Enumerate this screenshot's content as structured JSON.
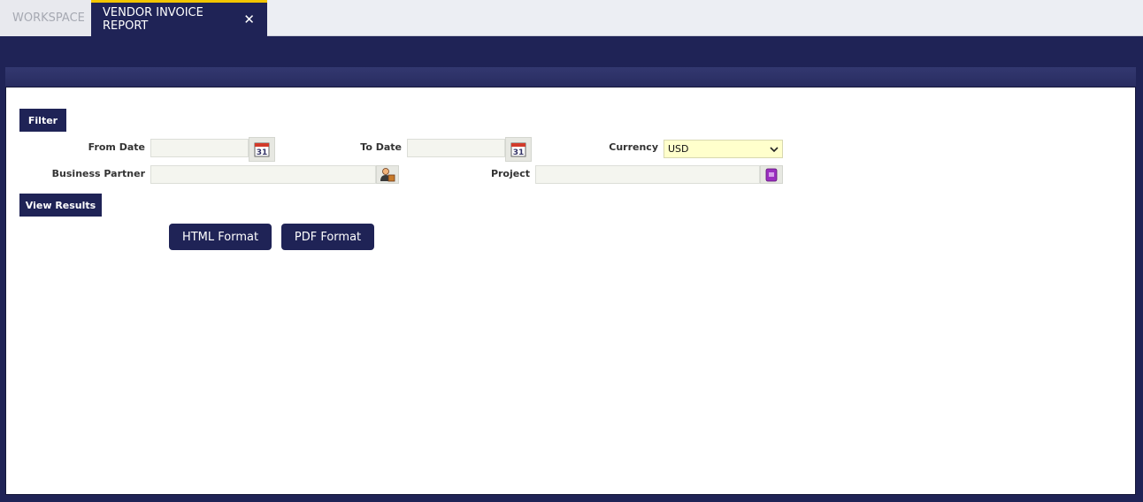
{
  "tabs": {
    "workspace": "WORKSPACE",
    "active": "VENDOR INVOICE REPORT",
    "close_glyph": "✕"
  },
  "filter": {
    "filter_button": "Filter",
    "from_date_label": "From Date",
    "from_date_value": "",
    "to_date_label": "To Date",
    "to_date_value": "",
    "currency_label": "Currency",
    "currency_value": "USD",
    "business_partner_label": "Business Partner",
    "business_partner_value": "",
    "project_label": "Project",
    "project_value": ""
  },
  "actions": {
    "view_results": "View Results",
    "html_format": "HTML Format",
    "pdf_format": "PDF Format"
  },
  "icons": {
    "calendar_day": "31",
    "calendar": "calendar-icon",
    "business_partner": "business-partner-icon",
    "project": "project-icon",
    "dropdown": "chevron-down-icon"
  },
  "colors": {
    "brand_navy": "#1f2356",
    "active_tab_accent": "#f2c500",
    "currency_field": "#ffffcc"
  }
}
